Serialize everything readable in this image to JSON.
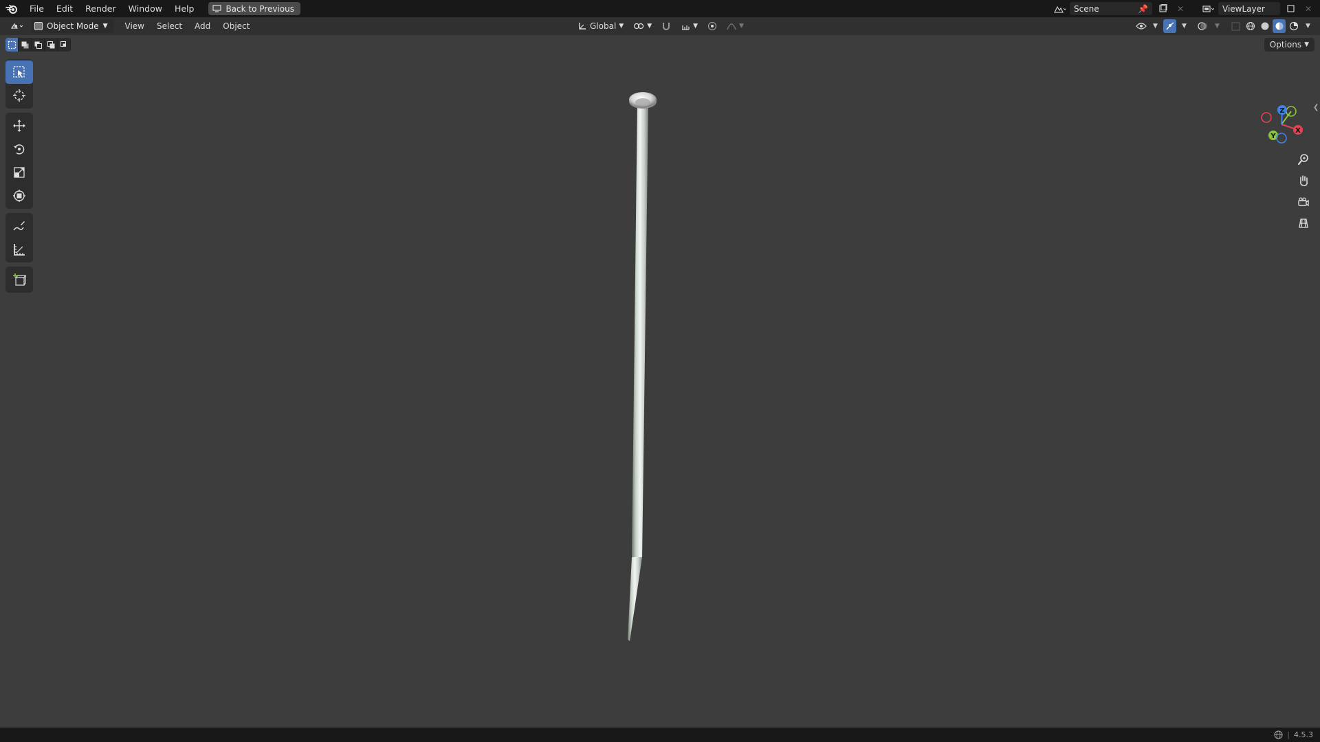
{
  "topbar": {
    "menus": [
      "File",
      "Edit",
      "Render",
      "Window",
      "Help"
    ],
    "back_button": "Back to Previous",
    "scene_name": "Scene",
    "view_layer_name": "ViewLayer"
  },
  "header": {
    "mode": "Object Mode",
    "menus": [
      "View",
      "Select",
      "Add",
      "Object"
    ],
    "transform_orientation": "Global"
  },
  "viewport": {
    "options_label": "Options",
    "gizmo_axes": {
      "x": "X",
      "y": "Y",
      "z": "Z"
    },
    "colors": {
      "x_axis": "#e3434f",
      "y_axis": "#8ac53b",
      "z_axis": "#3f84e5",
      "accent": "#4772b3",
      "background": "#3d3d3d"
    }
  },
  "toolbar": {
    "tools": [
      {
        "name": "select-box-tool",
        "icon": "select-box-icon",
        "active": true
      },
      {
        "name": "cursor-tool",
        "icon": "cursor-icon"
      },
      {
        "name": "move-tool",
        "icon": "move-icon"
      },
      {
        "name": "rotate-tool",
        "icon": "rotate-icon"
      },
      {
        "name": "scale-tool",
        "icon": "scale-icon"
      },
      {
        "name": "transform-tool",
        "icon": "transform-icon"
      },
      {
        "name": "annotate-tool",
        "icon": "annotate-icon"
      },
      {
        "name": "measure-tool",
        "icon": "measure-icon"
      },
      {
        "name": "add-cube-tool",
        "icon": "add-cube-icon"
      }
    ]
  },
  "statusbar": {
    "version": "4.5.3"
  }
}
